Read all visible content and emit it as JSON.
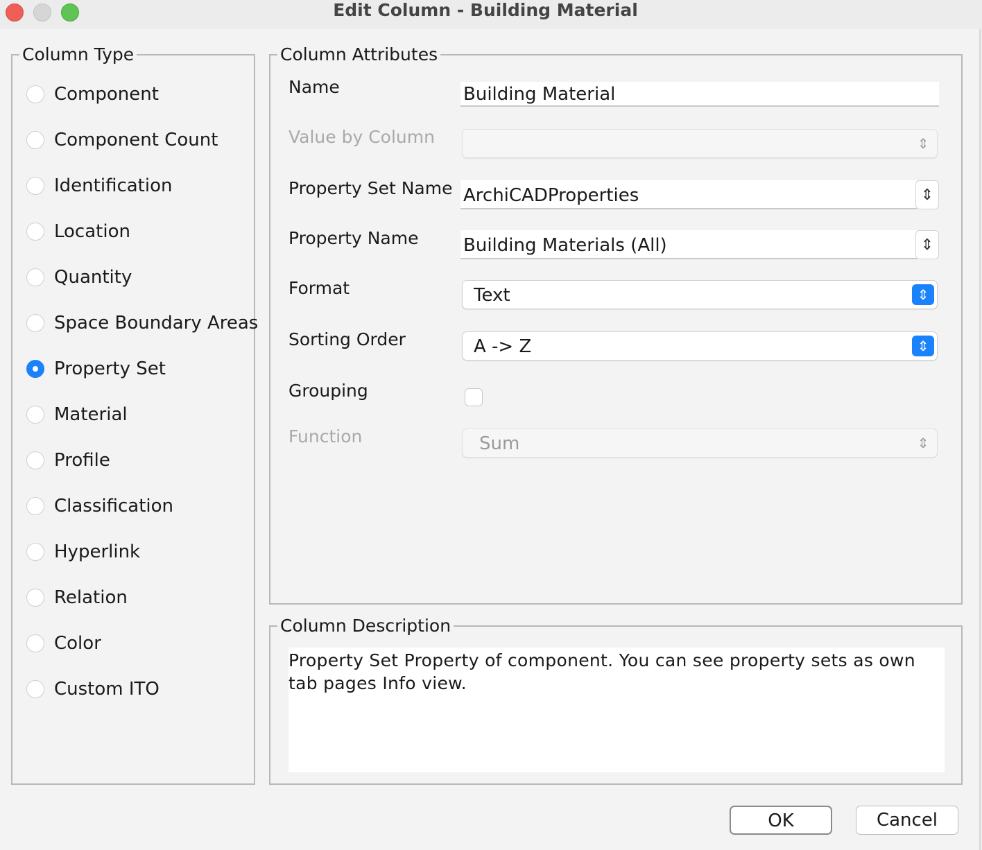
{
  "window": {
    "title": "Edit Column - Building Material"
  },
  "column_type": {
    "title": "Column Type",
    "options": [
      {
        "label": "Component",
        "selected": false
      },
      {
        "label": "Component Count",
        "selected": false
      },
      {
        "label": "Identification",
        "selected": false
      },
      {
        "label": "Location",
        "selected": false
      },
      {
        "label": "Quantity",
        "selected": false
      },
      {
        "label": "Space Boundary Areas",
        "selected": false
      },
      {
        "label": "Property Set",
        "selected": true
      },
      {
        "label": "Material",
        "selected": false
      },
      {
        "label": "Profile",
        "selected": false
      },
      {
        "label": "Classification",
        "selected": false
      },
      {
        "label": "Hyperlink",
        "selected": false
      },
      {
        "label": "Relation",
        "selected": false
      },
      {
        "label": "Color",
        "selected": false
      },
      {
        "label": "Custom ITO",
        "selected": false
      }
    ]
  },
  "attributes": {
    "title": "Column Attributes",
    "name_label": "Name",
    "name_value": "Building Material",
    "value_by_column_label": "Value by Column",
    "value_by_column_value": "",
    "property_set_name_label": "Property Set Name",
    "property_set_name_value": "ArchiCADProperties",
    "property_name_label": "Property Name",
    "property_name_value": "Building Materials (All)",
    "format_label": "Format",
    "format_value": "Text",
    "sorting_order_label": "Sorting Order",
    "sorting_order_value": "A -> Z",
    "grouping_label": "Grouping",
    "grouping_checked": false,
    "function_label": "Function",
    "function_value": "Sum"
  },
  "description": {
    "title": "Column Description",
    "text": "Property Set Property of component. You can see property sets as own tab pages Info view."
  },
  "buttons": {
    "ok": "OK",
    "cancel": "Cancel"
  },
  "colors": {
    "accent": "#1a82fb",
    "close": "#ee5f57",
    "maximize": "#5fc453"
  }
}
